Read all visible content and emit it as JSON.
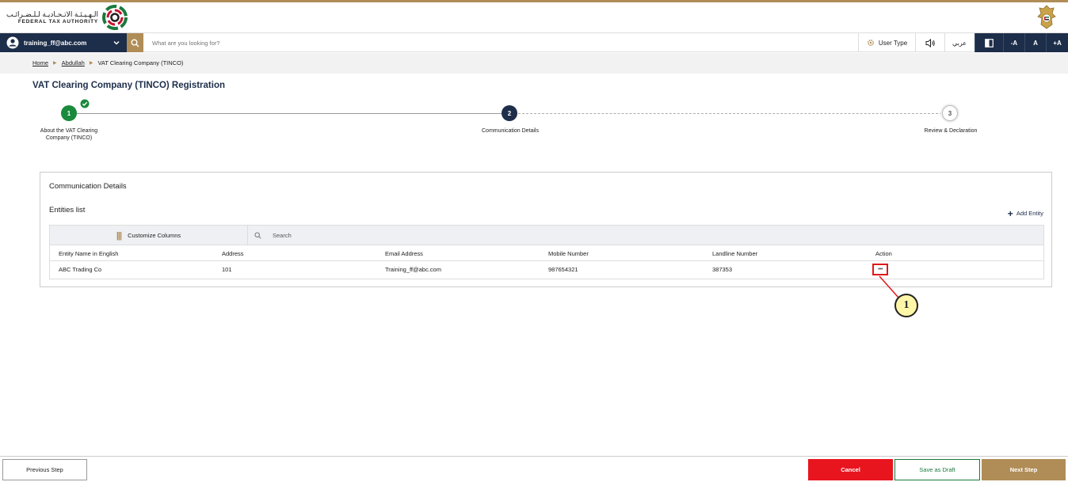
{
  "header": {
    "logo_ar": "الـهـيـئـة الاتـحـاديـة لـلـضـرائـب",
    "logo_en": "FEDERAL TAX AUTHORITY",
    "brand_color": "#b08d57",
    "navy_color": "#1d2e4a"
  },
  "toolbar": {
    "user_email": "training_ff@abc.com",
    "search_placeholder": "What are you looking for?",
    "user_type_label": "User Type",
    "arabic_label": "عربي",
    "font_decrease": "-A",
    "font_normal": "A",
    "font_increase": "+A"
  },
  "breadcrumb": {
    "items": [
      "Home",
      "Abdullah",
      "VAT Clearing Company (TINCO)"
    ]
  },
  "page": {
    "title": "VAT Clearing Company (TINCO) Registration"
  },
  "stepper": {
    "steps": [
      {
        "number": "1",
        "label": "About the VAT Clearing Company (TINCO)",
        "status": "completed"
      },
      {
        "number": "2",
        "label": "Communication Details",
        "status": "active"
      },
      {
        "number": "3",
        "label": "Review & Declaration",
        "status": "pending"
      }
    ]
  },
  "card": {
    "title": "Communication Details",
    "entities_title": "Entities list",
    "add_entity_label": "Add Entity",
    "customize_columns_label": "Customize Columns",
    "search_placeholder": "Search",
    "columns": [
      "Entity Name in English",
      "Address",
      "Email Address",
      "Mobile Number",
      "Landline Number",
      "Action"
    ],
    "rows": [
      {
        "name": "ABC Trading Co",
        "address": "101",
        "email": "Training_ff@abc.com",
        "mobile": "987654321",
        "landline": "387353",
        "action": "•••"
      }
    ]
  },
  "callout": {
    "number": "1"
  },
  "footer": {
    "previous_label": "Previous Step",
    "cancel_label": "Cancel",
    "draft_label": "Save as Draft",
    "next_label": "Next Step"
  }
}
